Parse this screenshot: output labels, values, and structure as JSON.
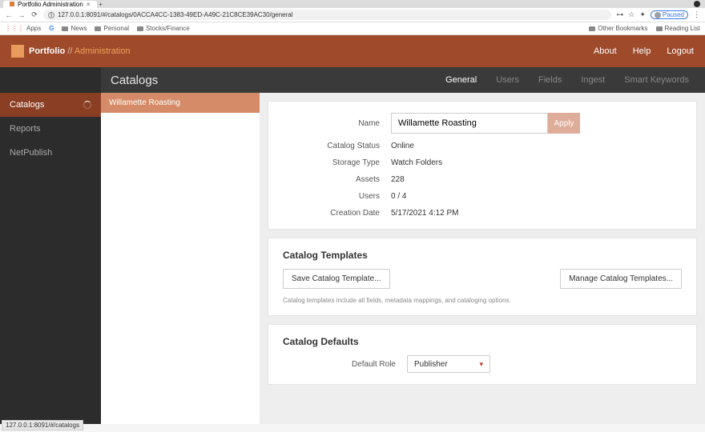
{
  "browser": {
    "tab_title": "Portfolio Administration",
    "url": "127.0.0.1:8091/#/catalogs/0ACCA4CC-1383-49ED-A49C-21C8CE39AC30/general",
    "paused_label": "Paused",
    "bookmarks": {
      "apps": "Apps",
      "news": "News",
      "personal": "Personal",
      "stocks": "Stocks/Finance",
      "other": "Other Bookmarks",
      "reading": "Reading List"
    },
    "status_url": "127.0.0.1:8091/#/catalogs"
  },
  "header": {
    "brand1": "Portfolio",
    "brand2": " // ",
    "brand3": "Administration",
    "links": {
      "about": "About",
      "help": "Help",
      "logout": "Logout"
    }
  },
  "page_title": "Catalogs",
  "tabs": {
    "general": "General",
    "users": "Users",
    "fields": "Fields",
    "ingest": "Ingest",
    "smart": "Smart Keywords"
  },
  "sidebar": {
    "items": [
      {
        "label": "Catalogs"
      },
      {
        "label": "Reports"
      },
      {
        "label": "NetPublish"
      }
    ]
  },
  "catalog_list": {
    "items": [
      {
        "label": "Willamette Roasting"
      }
    ]
  },
  "general_panel": {
    "labels": {
      "name": "Name",
      "apply": "Apply",
      "status": "Catalog Status",
      "storage": "Storage Type",
      "assets": "Assets",
      "users": "Users",
      "created": "Creation Date"
    },
    "values": {
      "name": "Willamette Roasting",
      "status": "Online",
      "storage": "Watch Folders",
      "assets": "228",
      "users": "0 / 4",
      "created": "5/17/2021 4:12 PM"
    }
  },
  "templates_panel": {
    "title": "Catalog Templates",
    "save_btn": "Save Catalog Template...",
    "manage_btn": "Manage Catalog Templates...",
    "hint": "Catalog templates include all fields, metadata mappings, and cataloging options."
  },
  "defaults_panel": {
    "title": "Catalog Defaults",
    "role_label": "Default Role",
    "role_value": "Publisher"
  }
}
